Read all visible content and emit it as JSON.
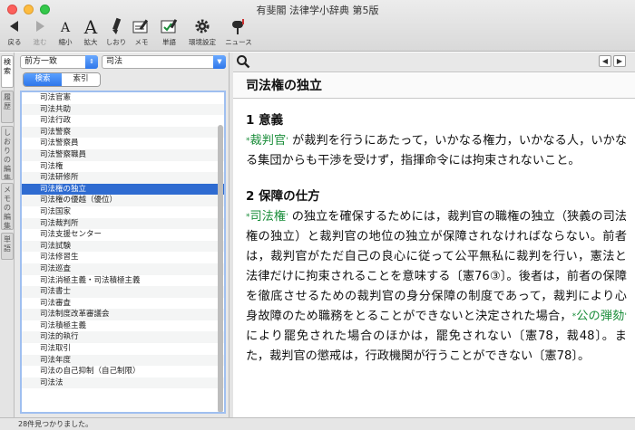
{
  "window": {
    "title": "有斐閣 法律学小辞典 第5版"
  },
  "toolbar": {
    "back": "戻る",
    "forward": "進む",
    "shrink": "縮小",
    "enlarge": "拡大",
    "bookmark": "しおり",
    "memo": "メモ",
    "wordbook": "単語",
    "settings": "環境設定",
    "news": "ニュース"
  },
  "side_tabs": [
    "検索",
    "履歴",
    "しおりの編集",
    "メモの編集",
    "単語"
  ],
  "search": {
    "mode": "前方一致",
    "query": "司法",
    "tabs": [
      "検索",
      "索引"
    ],
    "active_tab": "検索"
  },
  "results": [
    "司法官憲",
    "司法共助",
    "司法行政",
    "司法警察",
    "司法警察員",
    "司法警察職員",
    "司法権",
    "司法研修所",
    "司法権の独立",
    "司法権の優越（優位）",
    "司法国家",
    "司法裁判所",
    "司法支援センター",
    "司法試験",
    "司法修習生",
    "司法巡査",
    "司法消極主義・司法積極主義",
    "司法書士",
    "司法審査",
    "司法制度改革審議会",
    "司法積極主義",
    "司法的執行",
    "司法取引",
    "司法年度",
    "司法の自己抑制（自己制限）",
    "司法法"
  ],
  "selected_result": "司法権の独立",
  "article": {
    "title": "司法権の独立",
    "sections": [
      {
        "heading": "1 意義",
        "term": "裁判官",
        "text": " が裁判を行うにあたって，いかなる権力，いかなる人，いかなる集団からも干渉を受けず，指揮命令には拘束されないこと。"
      },
      {
        "heading": "2 保障の仕方",
        "term": "司法権",
        "text1": " の独立を確保するためには，裁判官の職権の独立（狭義の司法権の独立）と裁判官の地位の独立が保障されなければならない。前者は，裁判官がただ自己の良心に従って公平無私に裁判を行い，憲法と法律だけに拘束されることを意味する〔憲76③〕。後者は，前者の保障を徹底させるための裁判官の身分保障の制度であって，裁判により心身故障のため職務をとることができないと決定された場合，",
        "term2": "公の弾劾",
        "text2": " により罷免された場合のほかは，罷免されない〔憲78，裁48〕。また，裁判官の懲戒は，行政機関が行うことができない〔憲78〕。"
      }
    ]
  },
  "status": "28件見つかりました。",
  "colors": {
    "accent": "#2e6bd1",
    "term": "#1a8d3a"
  }
}
